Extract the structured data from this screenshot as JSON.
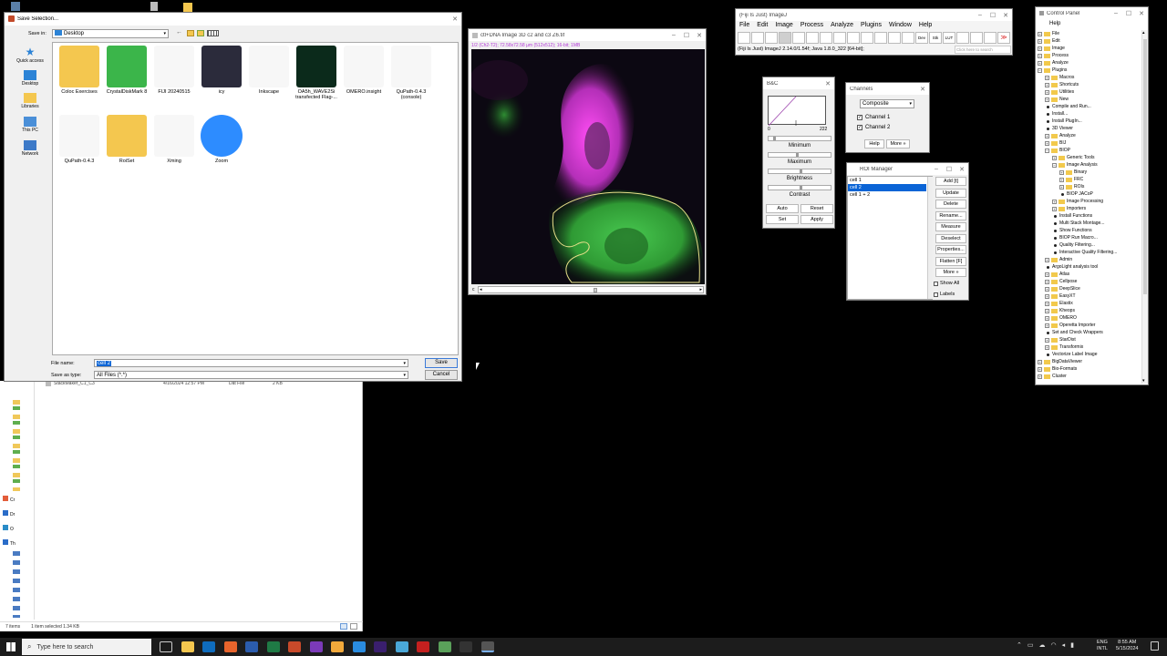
{
  "explorer": {
    "side_labels": [
      "Cr",
      "Dr",
      "O",
      "Th"
    ],
    "file_row": {
      "name": "StackMaker_C1_C3",
      "date": "4/16/2024 12:57 PM",
      "type": "Dat File",
      "size": "2 KB"
    },
    "status_items": "7 items",
    "status_selected": "1 item selected  1.34 KB"
  },
  "save_dialog": {
    "title": "Save Selection...",
    "save_in_label": "Save in:",
    "save_in_value": "Desktop",
    "nav": [
      "Quick access",
      "Desktop",
      "Libraries",
      "This PC",
      "Network"
    ],
    "files": [
      {
        "label": "Coloc Exercises",
        "icon": "folder-icon",
        "color": "#f4c74f"
      },
      {
        "label": "CrystalDiskMark 8",
        "icon": "crystaldiskmark-icon",
        "color": "#3bb54a"
      },
      {
        "label": "FIJI 20240515",
        "icon": "fiji-icon",
        "color": "#f7f7f7"
      },
      {
        "label": "icy",
        "icon": "icy-icon",
        "color": "#2b2b3b"
      },
      {
        "label": "Inkscape",
        "icon": "inkscape-icon",
        "color": "#f7f7f7"
      },
      {
        "label": "OA5h_WAVE2Si transfected Flag-...",
        "icon": "image-thumbnail-icon",
        "color": "#0b2a1b"
      },
      {
        "label": "OMERO.insight",
        "icon": "omero-icon",
        "color": "#f7f7f7"
      },
      {
        "label": "QuPath-0.4.3 (console)",
        "icon": "qupath-icon",
        "color": "#f7f7f7"
      },
      {
        "label": "QuPath-0.4.3",
        "icon": "qupath-icon",
        "color": "#f7f7f7"
      },
      {
        "label": "RoiSet",
        "icon": "zip-folder-icon",
        "color": "#f4c74f"
      },
      {
        "label": "Xming",
        "icon": "xming-icon",
        "color": "#f7f7f7"
      },
      {
        "label": "Zoom",
        "icon": "zoom-icon",
        "color": "#2d8cff"
      }
    ],
    "file_name_label": "File name:",
    "file_name_value": "cell 2",
    "save_as_type_label": "Save as type:",
    "save_as_type_value": "All Files (*.*)",
    "save_label": "Save",
    "cancel_label": "Cancel"
  },
  "image_window": {
    "title": "ctl+DNA Image 3D c2 and c3 Z6.tif",
    "info": "1/2 (Ch2-T2); 72.58x72.58 µm (512x512); 16-bit; 1MB",
    "slider_label": "c"
  },
  "fiji": {
    "title": "(Fiji Is Just) ImageJ",
    "menu": [
      "File",
      "Edit",
      "Image",
      "Process",
      "Analyze",
      "Plugins",
      "Window",
      "Help"
    ],
    "status": "(Fiji Is Just) ImageJ 2.14.0/1.54f; Java 1.8.0_322 [64-bit];",
    "search_placeholder": "Click here to search",
    "tools": [
      "Dev",
      "Stk",
      "LUT"
    ]
  },
  "bc": {
    "title": "B&C",
    "min_value": "0",
    "max_value": "222",
    "minimum": "Minimum",
    "maximum": "Maximum",
    "brightness": "Brightness",
    "contrast": "Contrast",
    "auto": "Auto",
    "reset": "Reset",
    "set": "Set",
    "apply": "Apply"
  },
  "channels": {
    "title": "Channels",
    "mode": "Composite",
    "ch1": "Channel 1",
    "ch2": "Channel 2",
    "help": "Help",
    "more": "More »"
  },
  "roi": {
    "title": "ROI Manager",
    "items": [
      "cell 1",
      "cell 2",
      "cell 1 + 2"
    ],
    "selected_index": 1,
    "buttons": [
      "Add [t]",
      "Update",
      "Delete",
      "Rename...",
      "Measure",
      "Deselect",
      "Properties...",
      "Flatten [F]",
      "More »"
    ],
    "show_all": "Show All",
    "labels": "Labels"
  },
  "control_panel": {
    "title": "Control Panel",
    "help": "Help",
    "tree": [
      {
        "d": 0,
        "k": "folder",
        "t": "File"
      },
      {
        "d": 0,
        "k": "folder",
        "t": "Edit"
      },
      {
        "d": 0,
        "k": "folder",
        "t": "Image"
      },
      {
        "d": 0,
        "k": "folder",
        "t": "Process"
      },
      {
        "d": 0,
        "k": "folder",
        "t": "Analyze"
      },
      {
        "d": 0,
        "k": "open",
        "t": "Plugins"
      },
      {
        "d": 1,
        "k": "folder",
        "t": "Macros"
      },
      {
        "d": 1,
        "k": "folder",
        "t": "Shortcuts"
      },
      {
        "d": 1,
        "k": "folder",
        "t": "Utilities"
      },
      {
        "d": 1,
        "k": "folder",
        "t": "New"
      },
      {
        "d": 1,
        "k": "leaf",
        "t": "Compile and Run..."
      },
      {
        "d": 1,
        "k": "leaf",
        "t": "Install..."
      },
      {
        "d": 1,
        "k": "leaf",
        "t": "Install PlugIn..."
      },
      {
        "d": 1,
        "k": "leaf",
        "t": "3D Viewer"
      },
      {
        "d": 1,
        "k": "folder",
        "t": "Analyze"
      },
      {
        "d": 1,
        "k": "folder",
        "t": "BIJ"
      },
      {
        "d": 1,
        "k": "open",
        "t": "BIOP"
      },
      {
        "d": 2,
        "k": "folder",
        "t": "Generic Tools"
      },
      {
        "d": 2,
        "k": "open",
        "t": "Image Analysis"
      },
      {
        "d": 3,
        "k": "folder",
        "t": "Binary"
      },
      {
        "d": 3,
        "k": "folder",
        "t": "FRC"
      },
      {
        "d": 3,
        "k": "folder",
        "t": "ROIs"
      },
      {
        "d": 3,
        "k": "leaf",
        "t": "BIOP JACoP"
      },
      {
        "d": 2,
        "k": "folder",
        "t": "Image Processing"
      },
      {
        "d": 2,
        "k": "folder",
        "t": "Importers"
      },
      {
        "d": 2,
        "k": "leaf",
        "t": "Install Functions"
      },
      {
        "d": 2,
        "k": "leaf",
        "t": "Multi Stack Montage..."
      },
      {
        "d": 2,
        "k": "leaf",
        "t": "Show Functions"
      },
      {
        "d": 2,
        "k": "leaf",
        "t": "BIOP Run Macro..."
      },
      {
        "d": 2,
        "k": "leaf",
        "t": "Quality Filtering..."
      },
      {
        "d": 2,
        "k": "leaf",
        "t": "Interactive Quality Filtering..."
      },
      {
        "d": 1,
        "k": "folder",
        "t": "Admin"
      },
      {
        "d": 1,
        "k": "leaf",
        "t": "ArgoLight analysis tool"
      },
      {
        "d": 1,
        "k": "folder",
        "t": "Atlas"
      },
      {
        "d": 1,
        "k": "folder",
        "t": "Cellpose"
      },
      {
        "d": 1,
        "k": "folder",
        "t": "DeepSlice"
      },
      {
        "d": 1,
        "k": "folder",
        "t": "EasyXT"
      },
      {
        "d": 1,
        "k": "folder",
        "t": "Elastix"
      },
      {
        "d": 1,
        "k": "folder",
        "t": "Kheops"
      },
      {
        "d": 1,
        "k": "folder",
        "t": "OMERO"
      },
      {
        "d": 1,
        "k": "folder",
        "t": "Operetta Importer"
      },
      {
        "d": 1,
        "k": "leaf",
        "t": "Set and Check Wrappers"
      },
      {
        "d": 1,
        "k": "folder",
        "t": "StarDist"
      },
      {
        "d": 1,
        "k": "folder",
        "t": "Transformix"
      },
      {
        "d": 1,
        "k": "leaf",
        "t": "Vectorize Label Image"
      },
      {
        "d": 0,
        "k": "folder",
        "t": "BigDataViewer"
      },
      {
        "d": 0,
        "k": "folder",
        "t": "Bio-Formats"
      },
      {
        "d": 0,
        "k": "folder",
        "t": "Cluster"
      }
    ]
  },
  "taskbar": {
    "search_placeholder": "Type here to search",
    "lang1": "ENG",
    "lang2": "INTL",
    "time": "8:55 AM",
    "date": "5/15/2024"
  }
}
